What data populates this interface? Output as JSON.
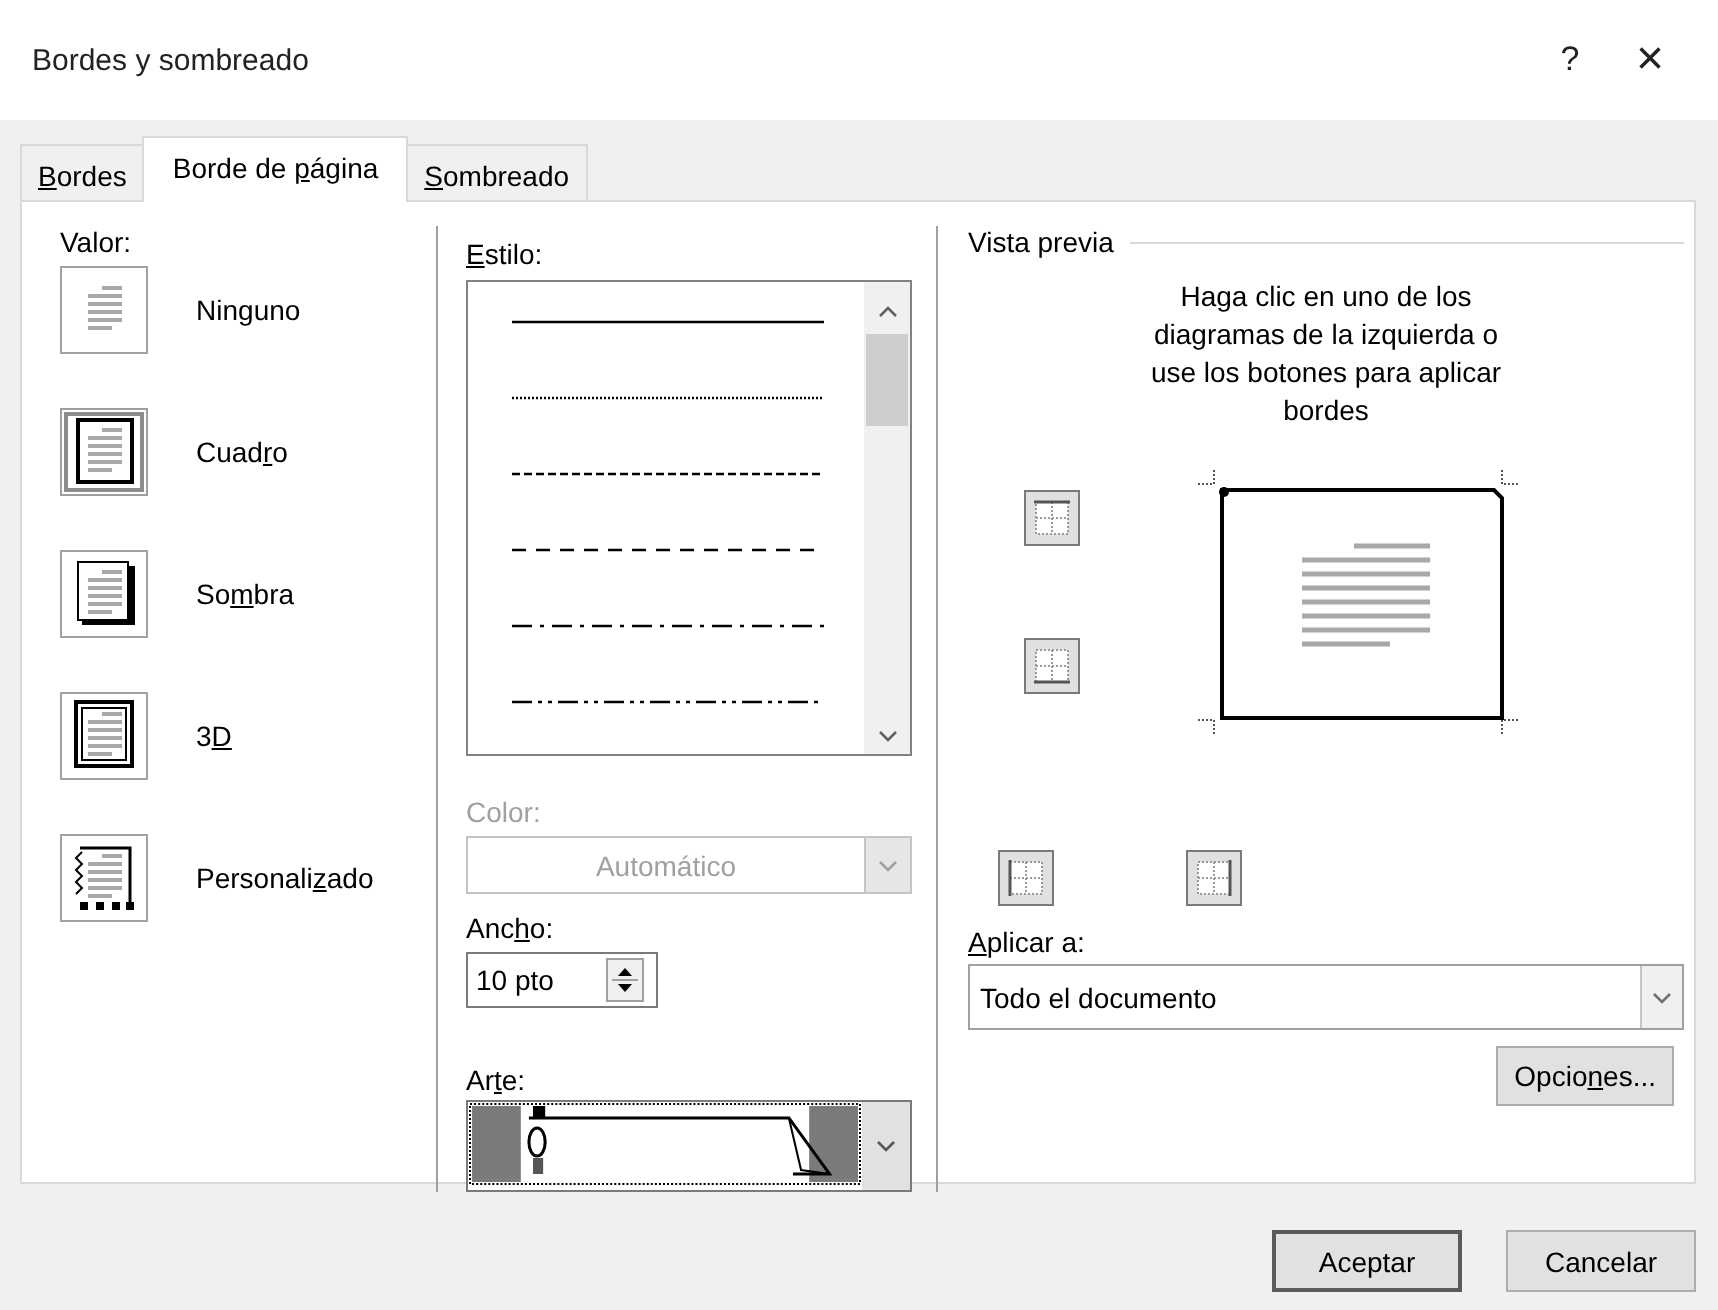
{
  "window": {
    "title": "Bordes y sombreado",
    "help": "?",
    "close": "×"
  },
  "tabs": [
    {
      "label": {
        "key": "B",
        "post": "ordes"
      },
      "selected": false
    },
    {
      "label": {
        "pre": "Borde de ",
        "key": "p",
        "post": "ágina"
      },
      "selected": true
    },
    {
      "label": {
        "key": "S",
        "post": "ombreado"
      },
      "selected": false
    }
  ],
  "value": {
    "label": "Valor:",
    "options": [
      {
        "kind": "none",
        "label": {
          "pre": "Nin",
          "key": "g",
          "post": "uno"
        },
        "selected": false
      },
      {
        "kind": "box",
        "label": {
          "pre": "Cuad",
          "key": "r",
          "post": "o"
        },
        "selected": true
      },
      {
        "kind": "shadow",
        "label": {
          "pre": "So",
          "key": "m",
          "post": "bra"
        },
        "selected": false
      },
      {
        "kind": "threed",
        "label": {
          "pre": "3",
          "key": "D"
        },
        "selected": false
      },
      {
        "kind": "custom",
        "label": {
          "pre": "Personali",
          "key": "z",
          "post": "ado"
        },
        "selected": false
      }
    ]
  },
  "style": {
    "label": {
      "key": "E",
      "post": "stilo:"
    },
    "lines": [
      {
        "kind": "solid"
      },
      {
        "kind": "dotted"
      },
      {
        "kind": "dashed"
      },
      {
        "kind": "long-dashed"
      },
      {
        "kind": "dash-dot"
      },
      {
        "kind": "dash-dot-dot"
      }
    ]
  },
  "color": {
    "label": "Color:",
    "value": "Automático",
    "disabled": true
  },
  "width": {
    "label": {
      "pre": "Anc",
      "key": "h",
      "post": "o:"
    },
    "value": "10 pto"
  },
  "art": {
    "label": {
      "pre": "Ar",
      "key": "t",
      "post": "e:"
    }
  },
  "preview": {
    "title": "Vista previa",
    "instructions": "Haga clic en uno de los diagramas de la izquierda o use los botones para aplicar bordes",
    "edge_buttons": [
      {
        "kind": "top"
      },
      {
        "kind": "bottom"
      },
      {
        "kind": "left"
      },
      {
        "kind": "right"
      }
    ]
  },
  "apply": {
    "label": {
      "key": "A",
      "post": "plicar a:"
    },
    "value": "Todo el documento"
  },
  "options_button": {
    "label": {
      "pre": "Opcio",
      "key": "n",
      "post": "es..."
    }
  },
  "buttons": [
    {
      "label": "Aceptar",
      "default": true
    },
    {
      "label": "Cancelar",
      "default": false
    }
  ]
}
